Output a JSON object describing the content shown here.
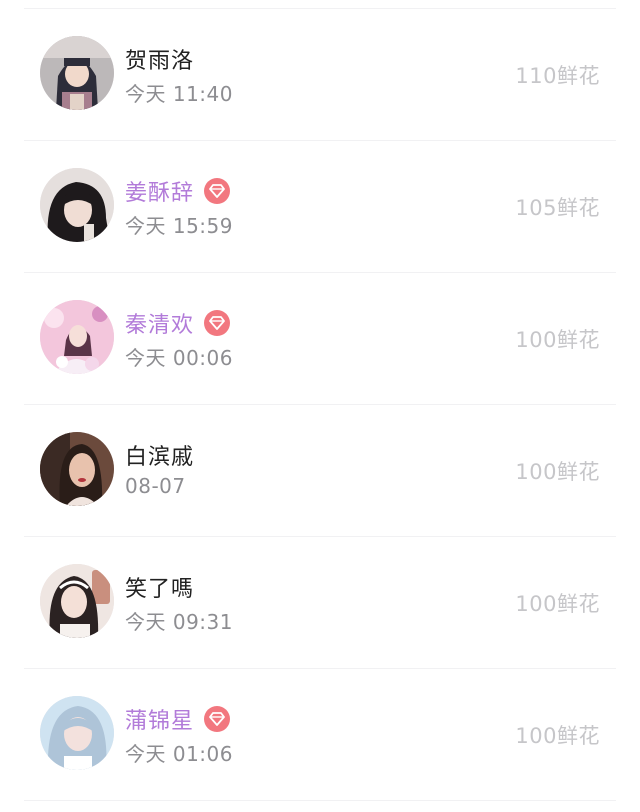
{
  "colors": {
    "vip_name": "#b27bd9",
    "normal_name": "#222222",
    "time": "#8d8d91",
    "gift": "#c6c6c9",
    "vip_badge": "#f2777f"
  },
  "items": [
    {
      "name": "贺雨洛",
      "vip": false,
      "time": "今天 11:40",
      "gift": "110鲜花",
      "avatar_icon": "avatar-anime-girl"
    },
    {
      "name": "姜酥辞",
      "vip": true,
      "time": "今天 15:59",
      "gift": "105鲜花",
      "avatar_icon": "avatar-girl-dark-hair"
    },
    {
      "name": "秦清欢",
      "vip": true,
      "time": "今天 00:06",
      "gift": "100鲜花",
      "avatar_icon": "avatar-girl-pink-dress"
    },
    {
      "name": "白滨戚",
      "vip": false,
      "time": "08-07",
      "gift": "100鲜花",
      "avatar_icon": "avatar-girl-red-lips"
    },
    {
      "name": "笑了嗎",
      "vip": false,
      "time": "今天 09:31",
      "gift": "100鲜花",
      "avatar_icon": "avatar-girl-selfie"
    },
    {
      "name": "蒲锦星",
      "vip": true,
      "time": "今天 01:06",
      "gift": "100鲜花",
      "avatar_icon": "avatar-girl-silver-hair"
    }
  ]
}
